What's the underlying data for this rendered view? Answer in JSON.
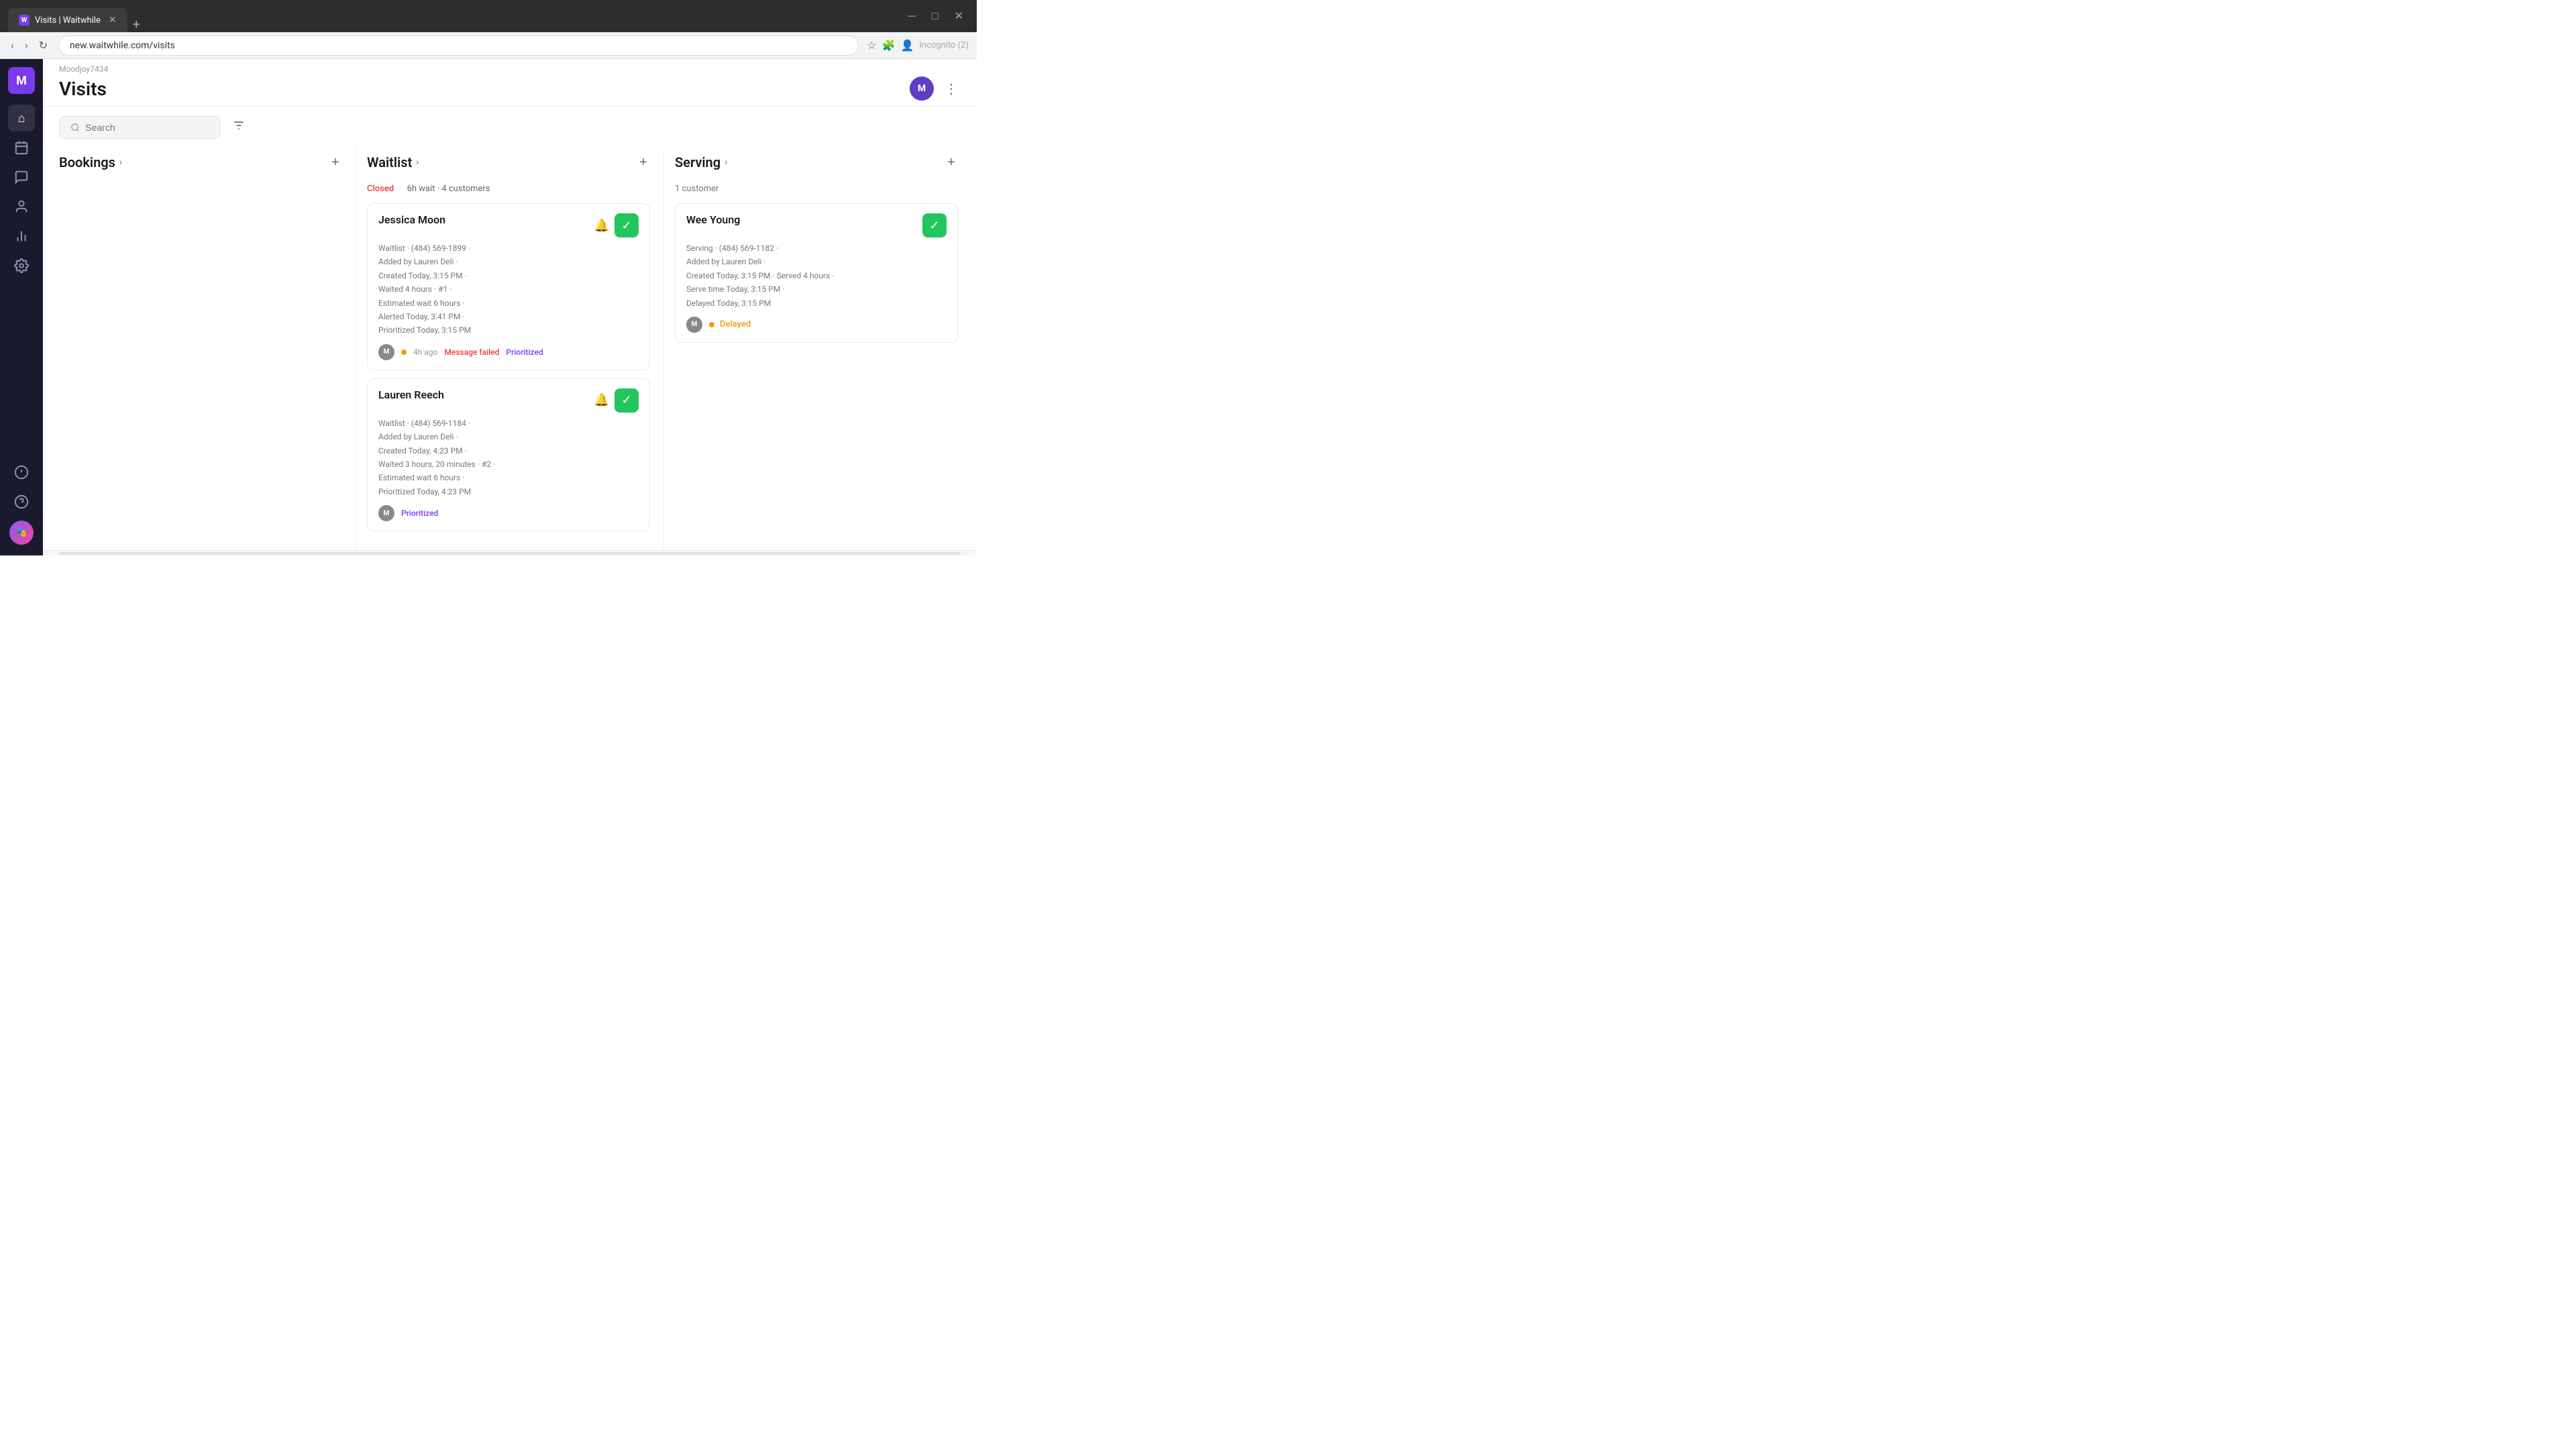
{
  "browser": {
    "tab_title": "Visits | Waitwhile",
    "url": "new.waitwhile.com/visits",
    "new_tab_label": "+",
    "incognito_label": "Incognito (2)"
  },
  "app": {
    "org_name": "Moodjoy7434",
    "page_title": "Visits",
    "user_initial": "M"
  },
  "sidebar": {
    "logo_initial": "M",
    "items": [
      {
        "name": "home",
        "icon": "⌂"
      },
      {
        "name": "calendar",
        "icon": "📅"
      },
      {
        "name": "chat",
        "icon": "💬"
      },
      {
        "name": "users",
        "icon": "👤"
      },
      {
        "name": "chart",
        "icon": "📊"
      },
      {
        "name": "settings",
        "icon": "⚙"
      }
    ]
  },
  "toolbar": {
    "search_placeholder": "Search",
    "filter_icon": "≡"
  },
  "columns": {
    "bookings": {
      "title": "Bookings",
      "add_label": "+",
      "customer_count": null
    },
    "waitlist": {
      "title": "Waitlist",
      "add_label": "+",
      "status": "Closed",
      "wait_info": "6h wait · 4 customers",
      "customers": [
        {
          "name": "Jessica Moon",
          "detail1": "Waitlist · (484) 569-1899 ·",
          "detail2": "Added by Lauren Deli ·",
          "detail3": "Created Today, 3:15 PM ·",
          "detail4": "Waited 4 hours · #1 ·",
          "detail5": "Estimated wait 6 hours ·",
          "detail6": "Alerted Today, 3:41 PM ·",
          "detail7": "Prioritized Today, 3:15 PM",
          "footer_avatar_initial": "M",
          "footer_time": "4h ago",
          "footer_message_status": "Message failed",
          "footer_priority": "Prioritized"
        },
        {
          "name": "Lauren Reech",
          "detail1": "Waitlist · (484) 569-1184 ·",
          "detail2": "Added by Lauren Deli ·",
          "detail3": "Created Today, 4:23 PM ·",
          "detail4": "Waited 3 hours, 20 minutes · #2 ·",
          "detail5": "Estimated wait 6 hours ·",
          "detail6": "Prioritized Today, 4:23 PM",
          "footer_avatar_initial": "M",
          "footer_time": null,
          "footer_message_status": null,
          "footer_priority": "Prioritized"
        }
      ]
    },
    "serving": {
      "title": "Serving",
      "add_label": "+",
      "customer_count": "1 customer",
      "customers": [
        {
          "name": "Wee Young",
          "detail1": "Serving · (484) 569-1182 ·",
          "detail2": "Added by Lauren Deli ·",
          "detail3": "Created Today, 3:15 PM · Served 4 hours ·",
          "detail4": "Serve time Today, 3:15 PM ·",
          "detail5": "Delayed Today, 3:15 PM",
          "footer_avatar_initial": "M",
          "footer_delay_label": "Delayed"
        }
      ]
    }
  }
}
